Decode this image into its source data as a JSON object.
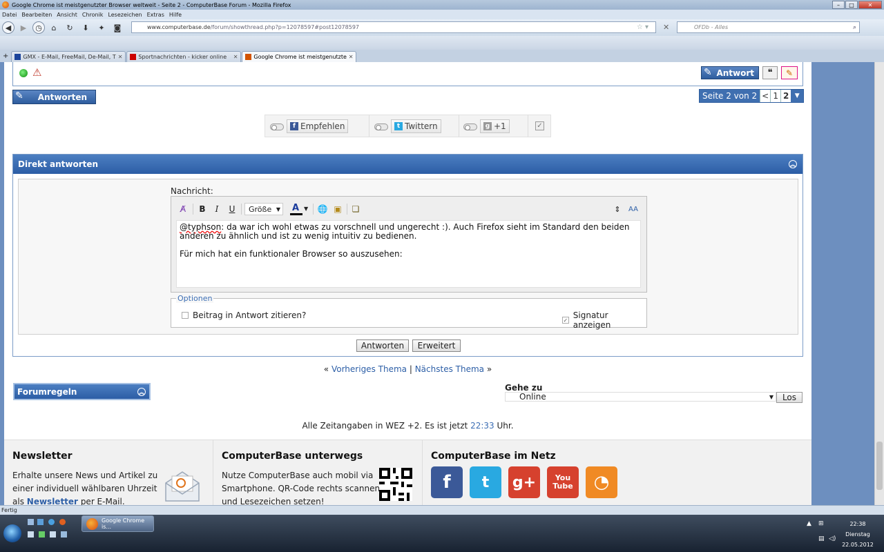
{
  "window": {
    "title": "Google Chrome ist meistgenutzter Browser weltweit - Seite 2 - ComputerBase Forum - Mozilla Firefox"
  },
  "menu": [
    "Datei",
    "Bearbeiten",
    "Ansicht",
    "Chronik",
    "Lesezeichen",
    "Extras",
    "Hilfe"
  ],
  "url": {
    "domain": "www.computerbase.de",
    "path": "/forum/showthread.php?p=12078597#post12078597"
  },
  "search": {
    "placeholder": "OFDb - Alles"
  },
  "tabs": [
    {
      "label": "GMX - E-Mail, FreeMail, De-Mail, The...",
      "active": false
    },
    {
      "label": "Sportnachrichten - kicker online",
      "active": false
    },
    {
      "label": "Google Chrome ist meistgenutzter Br...",
      "active": true
    }
  ],
  "post_actions": {
    "reply_label": "Antwort"
  },
  "reply_button": "Antworten",
  "pagination": {
    "label": "Seite 2 von 2",
    "prev": "<",
    "pages": [
      "1",
      "2"
    ],
    "current": "2"
  },
  "social": {
    "recommend": "Empfehlen",
    "tweet": "Twittern",
    "plusone": "+1"
  },
  "quick_reply": {
    "header": "Direkt antworten",
    "message_label": "Nachricht:",
    "size_select": "Größe",
    "text": {
      "mention": "@typhson",
      "line1_rest": ": da war ich wohl etwas zu vorschnell und ungerecht :). Auch Firefox sieht im Standard den beiden anderen zu ähnlich und ist zu wenig intuitiv zu bedienen.",
      "line2": "Für mich hat ein funktionaler Browser so auszusehen:"
    },
    "options_legend": "Optionen",
    "quote_option": "Beitrag in Antwort zitieren?",
    "quote_checked": false,
    "signature_option": "Signatur anzeigen",
    "signature_checked": true,
    "submit": "Antworten",
    "advanced": "Erweitert"
  },
  "thread_nav": {
    "left": "«",
    "prev": "Vorheriges Thema",
    "sep": "|",
    "next": "Nächstes Thema",
    "right": "»"
  },
  "forumregeln": "Forumregeln",
  "goto": {
    "label": "Gehe zu",
    "value": "Online",
    "button": "Los"
  },
  "timezone": {
    "prefix": "Alle Zeitangaben in WEZ +2. Es ist jetzt",
    "time": "22:33",
    "suffix": "Uhr."
  },
  "footer": {
    "newsletter": {
      "title": "Newsletter",
      "text1": "Erhalte unsere News und Artikel zu",
      "text2": "einer individuell wählbaren Uhrzeit",
      "text3_pre": "als",
      "text3_link": "Newsletter",
      "text3_post": "per E-Mail."
    },
    "mobile": {
      "title": "ComputerBase unterwegs",
      "text1": "Nutze ComputerBase auch mobil via",
      "text2": "Smartphone. QR-Code rechts scannen",
      "text3": "und Lesezeichen setzen!"
    },
    "net": {
      "title": "ComputerBase im Netz"
    }
  },
  "social_icons": [
    {
      "name": "facebook-icon",
      "glyph": "f",
      "color": "#3b5998"
    },
    {
      "name": "twitter-icon",
      "glyph": "t",
      "color": "#29a9e1"
    },
    {
      "name": "google-plus-icon",
      "glyph": "g+",
      "color": "#d6412e"
    },
    {
      "name": "youtube-icon",
      "glyph": "You Tube",
      "color": "#d6412e"
    },
    {
      "name": "rss-icon",
      "glyph": "rss",
      "color": "#f08a24"
    }
  ],
  "status": "Fertig",
  "taskbar": {
    "firefox_task": "Google Chrome is...",
    "time": "22:38",
    "day": "Dienstag",
    "date": "22.05.2012"
  },
  "colors": {
    "accent": "#2c5da5",
    "link": "#2d5fa7",
    "page_bg": "#6d8fbf"
  }
}
